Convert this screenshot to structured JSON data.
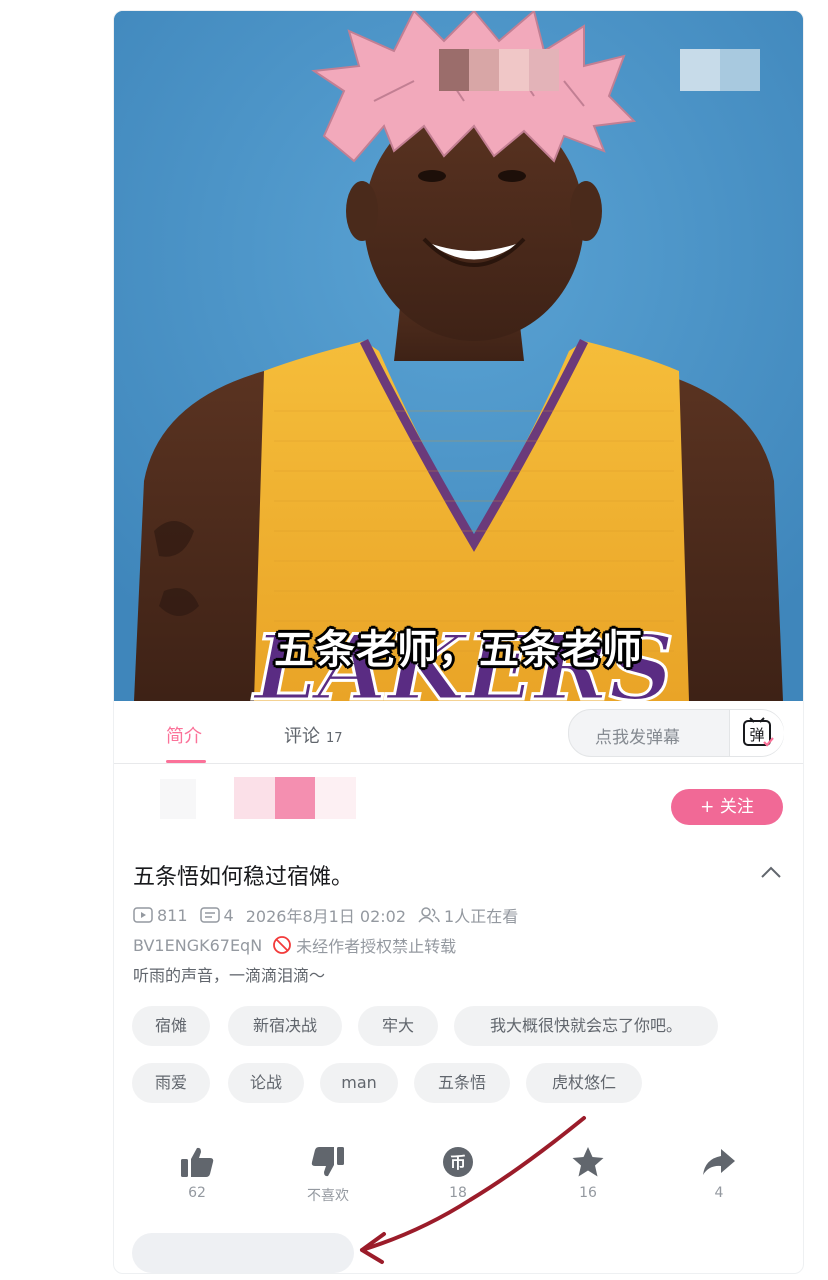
{
  "video": {
    "subtitle": "五条老师，五条老师",
    "jersey_text": "LAKERS"
  },
  "tabs": [
    {
      "label": "简介",
      "active": true
    },
    {
      "label": "评论",
      "count": "17",
      "active": false
    }
  ],
  "danmaku": {
    "placeholder": "点我发弹幕",
    "button_glyph": "弹"
  },
  "uploader": {
    "follow_label": "+ 关注"
  },
  "title": "五条悟如何稳过宿傩。",
  "meta": {
    "views": "811",
    "danmaku_count": "4",
    "datetime": "2026年8月1日 02:02",
    "watching": "1人正在看"
  },
  "bvid": "BV1ENGK67EqN",
  "copyright": "未经作者授权禁止转载",
  "description": "听雨的声音，一滴滴泪滴～",
  "tags_row1": [
    "宿傩",
    "新宿决战",
    "牢大",
    "我大概很快就会忘了你吧。"
  ],
  "tags_row2": [
    "雨爱",
    "论战",
    "man",
    "五条悟",
    "虎杖悠仁"
  ],
  "actions": [
    {
      "icon": "thumbs-up-icon",
      "label": "62"
    },
    {
      "icon": "thumbs-down-icon",
      "label": "不喜欢"
    },
    {
      "icon": "coin-icon",
      "label": "18"
    },
    {
      "icon": "star-icon",
      "label": "16"
    },
    {
      "icon": "share-icon",
      "label": "4"
    }
  ],
  "colors": {
    "accent": "#fb7299",
    "follow_bg": "#f16996",
    "muted": "#9499a0",
    "arrow": "#9b1c2a",
    "video_bg": "#4a95c9",
    "jersey": "#f3b331",
    "hair": "#f0a8b8"
  }
}
